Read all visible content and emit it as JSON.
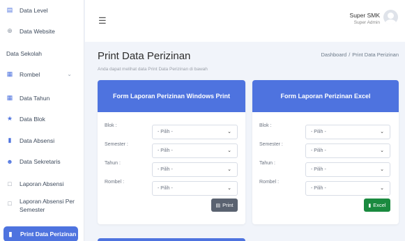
{
  "sidebar": {
    "items": [
      {
        "label": "Data Level",
        "icon": "document-icon"
      },
      {
        "label": "Data Website",
        "icon": "globe-icon"
      },
      {
        "label": "Data Sekolah",
        "icon": ""
      },
      {
        "label": "Rombel",
        "icon": "grid-icon"
      },
      {
        "label": "Data Tahun",
        "icon": "calendar-icon"
      },
      {
        "label": "Data Blok",
        "icon": "star-icon"
      },
      {
        "label": "Data Absensi",
        "icon": "clipboard-icon"
      },
      {
        "label": "Data Sekretaris",
        "icon": "users-icon"
      },
      {
        "label": "Laporan Absensi",
        "icon": "book-icon"
      },
      {
        "label": "Laporan Absensi Per Semester",
        "icon": "book-icon"
      },
      {
        "label": "Print Data Perizinan",
        "icon": "clipboard-icon"
      }
    ]
  },
  "header": {
    "user_name": "Super SMK",
    "user_role": "Super Admin"
  },
  "page": {
    "title": "Print Data Perizinan",
    "subtitle": "Anda dapat melihat data Print Data Perizinan di bawah",
    "breadcrumb_home": "Dashboard",
    "breadcrumb_sep": "/",
    "breadcrumb_current": "Print Data Perizinan"
  },
  "card_print": {
    "title": "Form Laporan Perizinan Windows Print",
    "fields": [
      {
        "label": "Blok :",
        "value": "- Pilih -"
      },
      {
        "label": "Semester :",
        "value": "- Pilih -"
      },
      {
        "label": "Tahun :",
        "value": "- Pilih -"
      },
      {
        "label": "Rombel :",
        "value": "- Pilih -"
      }
    ],
    "button": "Print"
  },
  "card_excel": {
    "title": "Form Laporan Perizinan Excel",
    "fields": [
      {
        "label": "Blok :",
        "value": "- Pilih -"
      },
      {
        "label": "Semester :",
        "value": "- Pilih -"
      },
      {
        "label": "Tahun :",
        "value": "- Pilih -"
      },
      {
        "label": "Rombel :",
        "value": "- Pilih -"
      }
    ],
    "button": "Excel"
  },
  "colors": {
    "primary": "#4e73df",
    "excel_button": "#1a8a3f",
    "print_button": "#5a6270"
  }
}
